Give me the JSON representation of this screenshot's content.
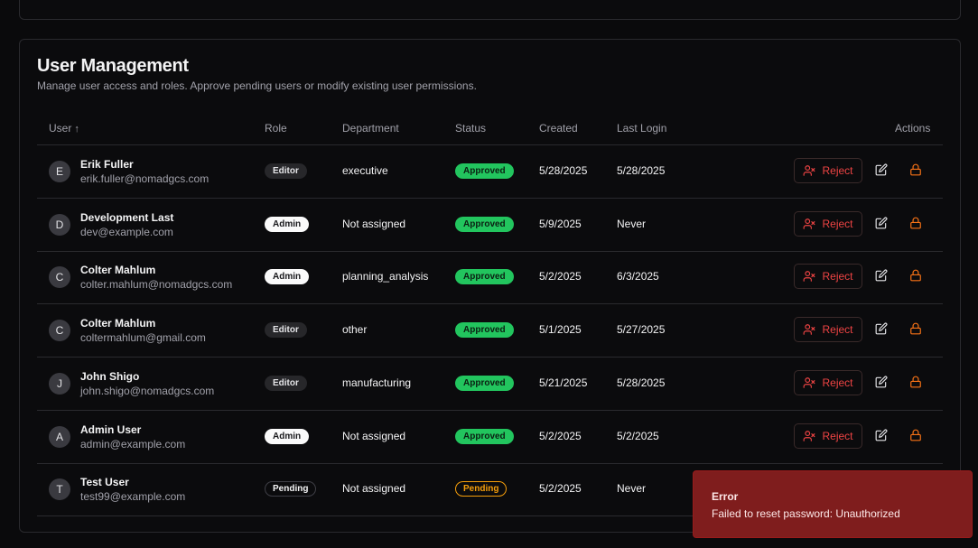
{
  "panel": {
    "title": "User Management",
    "description": "Manage user access and roles. Approve pending users or modify existing user permissions."
  },
  "table": {
    "headers": {
      "user": "User",
      "user_sort_icon": "↑",
      "role": "Role",
      "department": "Department",
      "status": "Status",
      "created": "Created",
      "last_login": "Last Login",
      "actions": "Actions"
    },
    "reject_label": "Reject",
    "rows": [
      {
        "initial": "E",
        "name": "Erik Fuller",
        "email": "erik.fuller@nomadgcs.com",
        "role": "Editor",
        "department": "executive",
        "status": "Approved",
        "created": "5/28/2025",
        "last_login": "5/28/2025"
      },
      {
        "initial": "D",
        "name": "Development Last",
        "email": "dev@example.com",
        "role": "Admin",
        "department": "Not assigned",
        "status": "Approved",
        "created": "5/9/2025",
        "last_login": "Never"
      },
      {
        "initial": "C",
        "name": "Colter Mahlum",
        "email": "colter.mahlum@nomadgcs.com",
        "role": "Admin",
        "department": "planning_analysis",
        "status": "Approved",
        "created": "5/2/2025",
        "last_login": "6/3/2025"
      },
      {
        "initial": "C",
        "name": "Colter Mahlum",
        "email": "coltermahlum@gmail.com",
        "role": "Editor",
        "department": "other",
        "status": "Approved",
        "created": "5/1/2025",
        "last_login": "5/27/2025"
      },
      {
        "initial": "J",
        "name": "John Shigo",
        "email": "john.shigo@nomadgcs.com",
        "role": "Editor",
        "department": "manufacturing",
        "status": "Approved",
        "created": "5/21/2025",
        "last_login": "5/28/2025"
      },
      {
        "initial": "A",
        "name": "Admin User",
        "email": "admin@example.com",
        "role": "Admin",
        "department": "Not assigned",
        "status": "Approved",
        "created": "5/2/2025",
        "last_login": "5/2/2025"
      },
      {
        "initial": "T",
        "name": "Test User",
        "email": "test99@example.com",
        "role": "Pending",
        "department": "Not assigned",
        "status": "Pending",
        "created": "5/2/2025",
        "last_login": "Never"
      }
    ]
  },
  "toast": {
    "title": "Error",
    "message": "Failed to reset password: Unauthorized"
  },
  "icons": {
    "reject": "user-x-icon",
    "edit": "edit-icon",
    "lock": "lock-icon"
  },
  "colors": {
    "approved": "#22c55e",
    "pending": "#f59e0b",
    "danger": "#ef4444",
    "lock": "#f97316",
    "toast_bg": "#7f1d1d"
  }
}
